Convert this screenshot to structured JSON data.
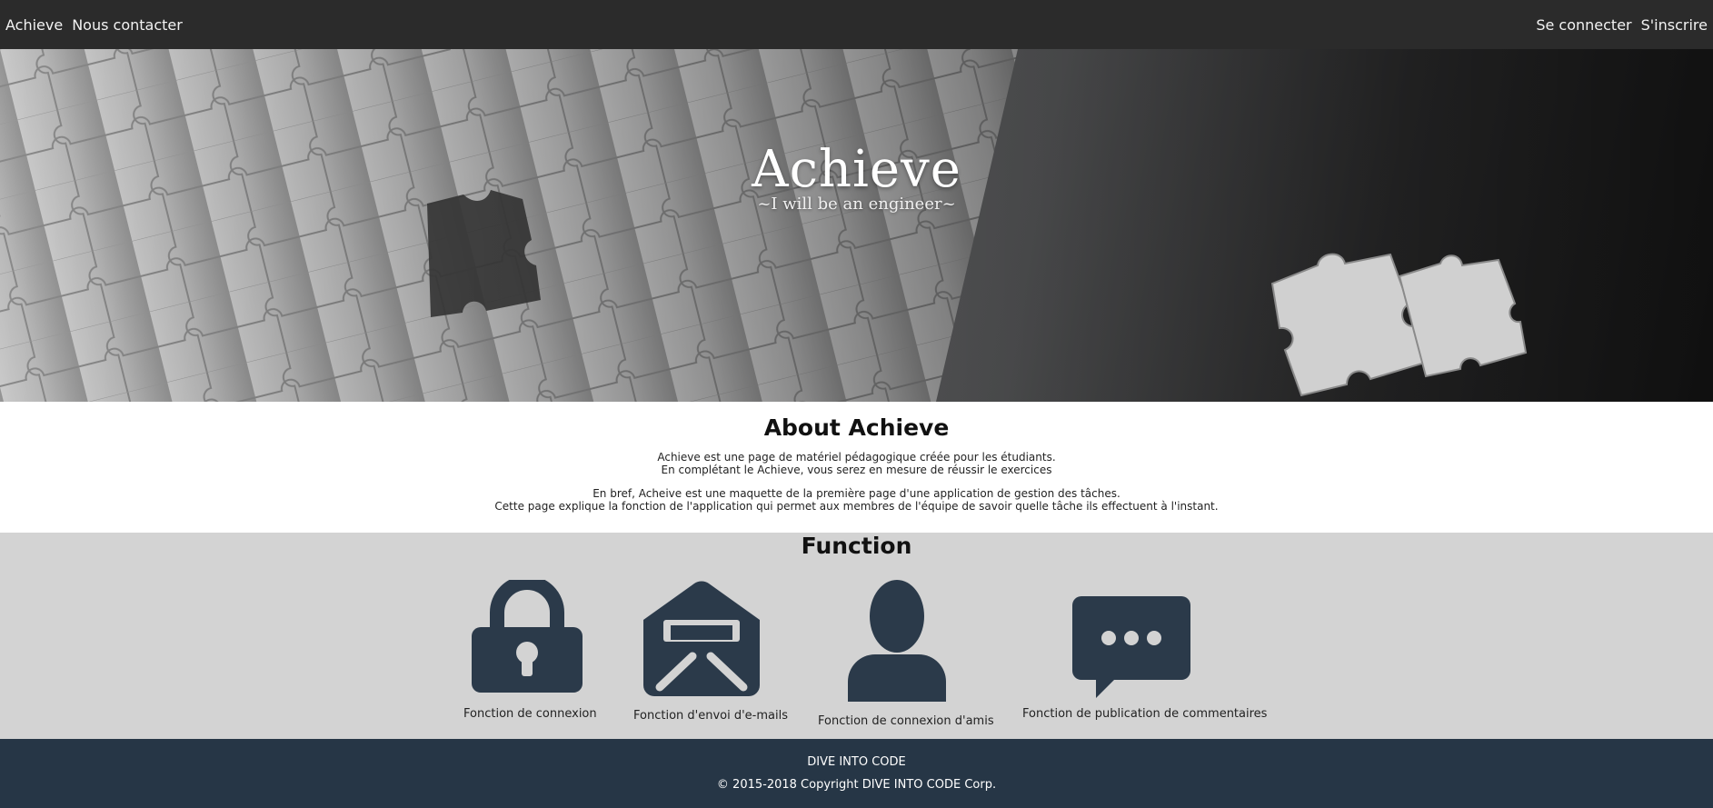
{
  "navbar": {
    "brand": "Achieve",
    "contact": "Nous contacter",
    "login": "Se connecter",
    "signup": "S'inscrire"
  },
  "hero": {
    "title": "Achieve",
    "subtitle": "~I will be an engineer~"
  },
  "about": {
    "title": "About Achieve",
    "lines": [
      "Achieve est une page de matériel pédagogique créée pour les étudiants.",
      "En complétant le Achieve, vous serez en mesure de réussir le exercices",
      "En bref, Acheive est une maquette de la première page d'une application de gestion des tâches.",
      "Cette page explique la fonction de l'application qui permet aux membres de l'équipe de savoir quelle tâche ils effectuent à l'instant."
    ]
  },
  "function": {
    "title": "Function",
    "icon_color": "#2b3a4a",
    "items": [
      {
        "icon": "lock-icon",
        "label": "Fonction de connexion"
      },
      {
        "icon": "envelope-icon",
        "label": "Fonction d'envoi d'e-mails"
      },
      {
        "icon": "user-icon",
        "label": "Fonction de connexion d'amis"
      },
      {
        "icon": "chat-bubble-icon",
        "label": "Fonction de publication de commentaires"
      }
    ]
  },
  "footer": {
    "company": "DIVE INTO CODE",
    "copyright": "© 2015-2018 Copyright DIVE INTO CODE Corp."
  },
  "colors": {
    "navbar_bg": "#2b2b2b",
    "function_bg": "#d3d3d3",
    "footer_bg": "#263646"
  }
}
